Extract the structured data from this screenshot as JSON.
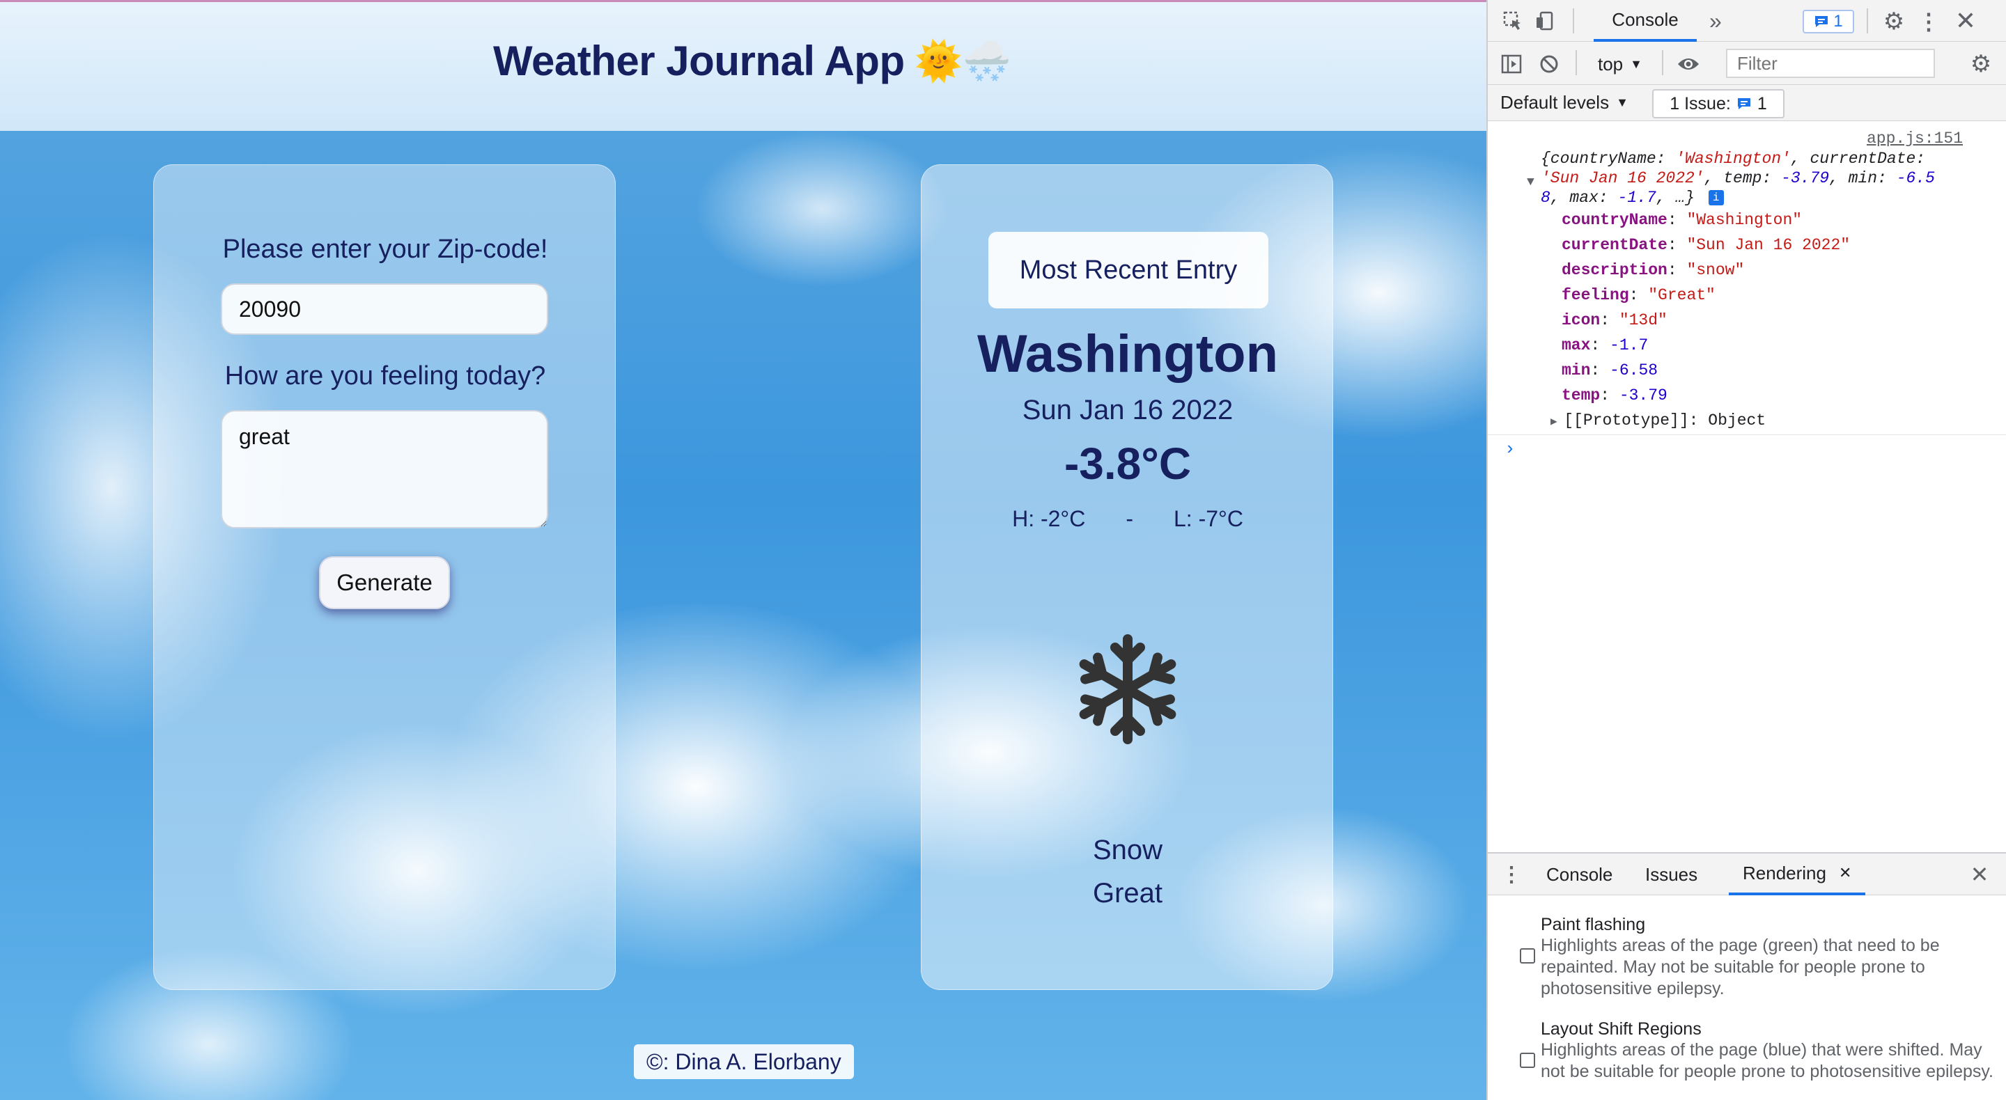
{
  "app": {
    "title": "Weather Journal App",
    "title_emoji": "🌞🌨️",
    "zip_label": "Please enter your Zip-code!",
    "zip_value": "20090",
    "feeling_label": "How are you feeling today?",
    "feeling_value": "great",
    "generate_label": "Generate",
    "entry": {
      "heading": "Most Recent Entry",
      "city": "Washington",
      "date": "Sun Jan 16 2022",
      "temp": "-3.8°C",
      "high": "H: -2°C",
      "separator": "-",
      "low": "L: -7°C",
      "icon": "snowflake-icon",
      "description": "Snow",
      "feeling": "Great"
    },
    "footer": "©: Dina A. Elorbany"
  },
  "devtools": {
    "tab_console": "Console",
    "issues_count": "1",
    "context": "top",
    "filter_placeholder": "Filter",
    "levels": "Default levels",
    "issue_pill_label": "1 Issue:",
    "issue_pill_count": "1",
    "log": {
      "source": "app.js:151",
      "summary_line1_prefix": "{countryName: ",
      "summary_line1_str": "'Washington'",
      "summary_line1_suffix": ", currentDate:",
      "summary_line2_str": "'Sun Jan 16 2022'",
      "summary_line2_mid": ", temp: ",
      "summary_line2_num": "-3.79",
      "summary_line2_mid2": ", min: ",
      "summary_line2_num2": "-6.5",
      "summary_line3_num": "8",
      "summary_line3_mid": ", max: ",
      "summary_line3_num2": "-1.7",
      "summary_line3_end": ", …}",
      "props": [
        {
          "key": "countryName",
          "value": "\"Washington\"",
          "kind": "string"
        },
        {
          "key": "currentDate",
          "value": "\"Sun Jan 16 2022\"",
          "kind": "string"
        },
        {
          "key": "description",
          "value": "\"snow\"",
          "kind": "string"
        },
        {
          "key": "feeling",
          "value": "\"Great\"",
          "kind": "string"
        },
        {
          "key": "icon",
          "value": "\"13d\"",
          "kind": "string"
        },
        {
          "key": "max",
          "value": "-1.7",
          "kind": "number"
        },
        {
          "key": "min",
          "value": "-6.58",
          "kind": "number"
        },
        {
          "key": "temp",
          "value": "-3.79",
          "kind": "number"
        }
      ],
      "prototype_key": "[[Prototype]]",
      "prototype_value": "Object"
    },
    "drawer_tabs": [
      "Console",
      "Issues",
      "Rendering"
    ],
    "rendering": {
      "paint_flashing_title": "Paint flashing",
      "paint_flashing_desc": "Highlights areas of the page (green) that need to be repainted. May not be suitable for people prone to photosensitive epilepsy.",
      "paint_flashing_checked": false,
      "layout_shift_title": "Layout Shift Regions",
      "layout_shift_desc": "Highlights areas of the page (blue) that were shifted. May not be suitable for people prone to photosensitive epilepsy.",
      "layout_shift_checked": false
    },
    "colors": {
      "accent": "#1a73e8",
      "property_key": "#881280",
      "string": "#c41a16",
      "number": "#1c00cf"
    }
  }
}
